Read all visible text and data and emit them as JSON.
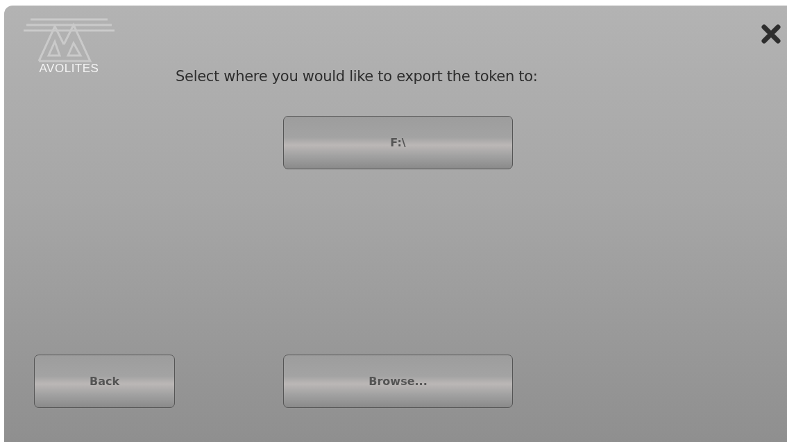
{
  "logo": {
    "text": "AVOLITES"
  },
  "title": "Select where you would like to export the token to:",
  "drives": [
    {
      "label": "F:\\"
    }
  ],
  "buttons": {
    "back": "Back",
    "browse": "Browse..."
  }
}
